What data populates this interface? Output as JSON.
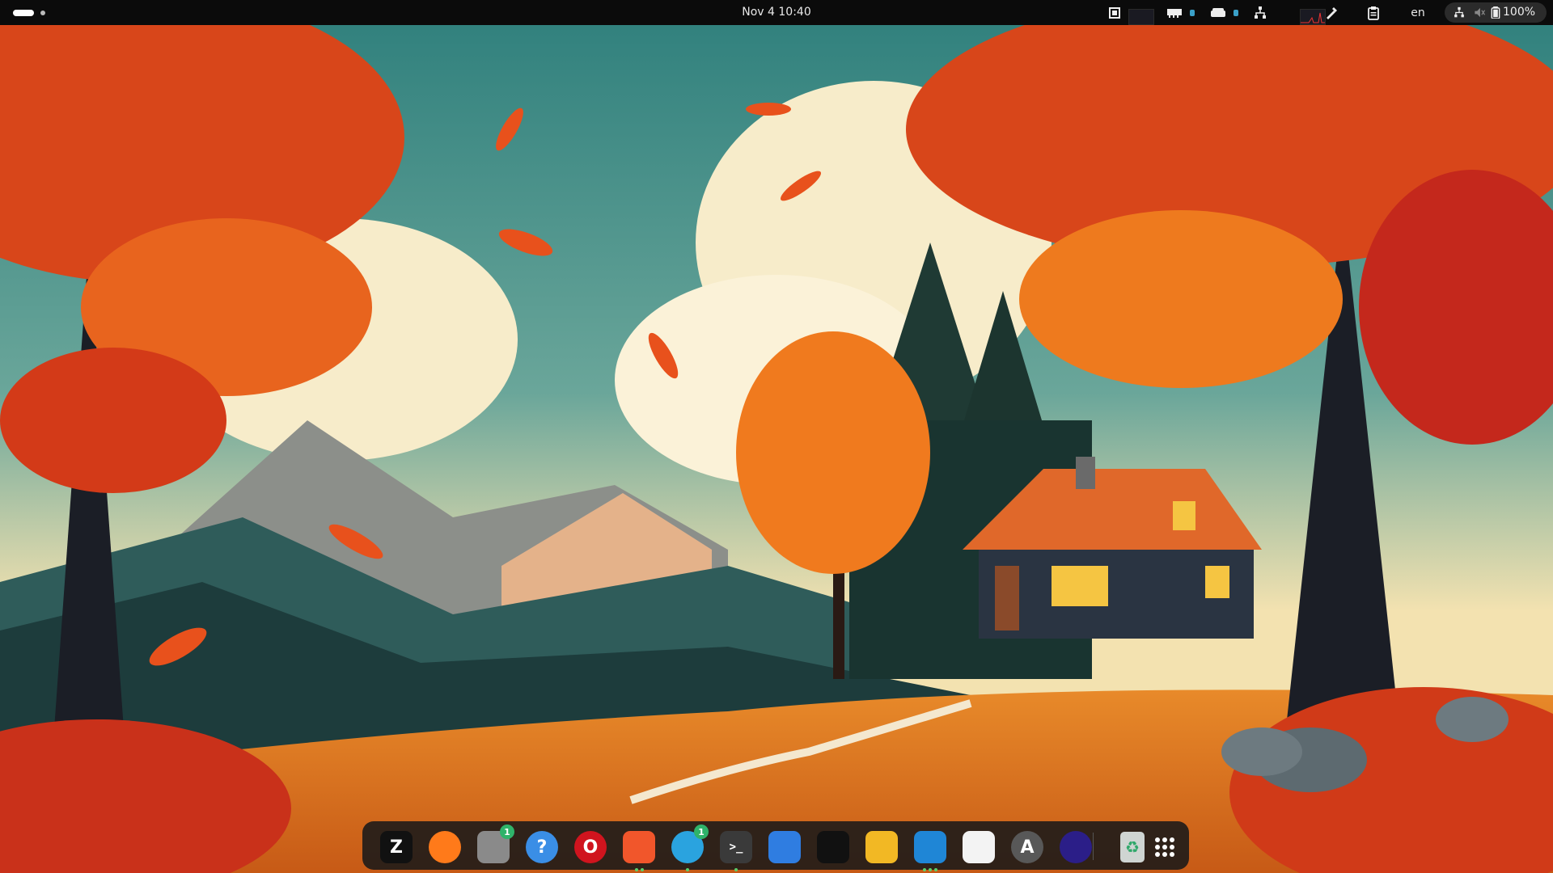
{
  "topbar": {
    "clock": "Nov 4  10:40",
    "keyboard_layout": "en",
    "battery": "100%"
  },
  "tray_icons": [
    "cpu-icon",
    "memory-icon",
    "disk-icon",
    "network-icon",
    "color-picker-icon",
    "clipboard-icon"
  ],
  "status_icons": [
    "network-icon",
    "volume-muted-icon",
    "battery-icon"
  ],
  "dock": {
    "apps": [
      {
        "name": "zed-editor",
        "glyph": "Z",
        "color": "#111111",
        "badge": "",
        "running": 0
      },
      {
        "name": "firefox",
        "glyph": "",
        "color": "#ff7a1a",
        "badge": "",
        "running": 0
      },
      {
        "name": "files",
        "glyph": "",
        "color": "#8a8a8a",
        "badge": "1",
        "running": 0
      },
      {
        "name": "help",
        "glyph": "?",
        "color": "#3a8ee6",
        "badge": "",
        "running": 0
      },
      {
        "name": "opera",
        "glyph": "O",
        "color": "#d0141e",
        "badge": "",
        "running": 0
      },
      {
        "name": "brave",
        "glyph": "",
        "color": "#f1562b",
        "badge": "",
        "running": 2
      },
      {
        "name": "telegram",
        "glyph": "",
        "color": "#2aa3df",
        "badge": "1",
        "running": 1
      },
      {
        "name": "terminal",
        "glyph": ">_",
        "color": "#3a3a3a",
        "badge": "",
        "running": 1
      },
      {
        "name": "text-editor",
        "glyph": "",
        "color": "#2f7de1",
        "badge": "",
        "running": 0
      },
      {
        "name": "app-black",
        "glyph": "",
        "color": "#111111",
        "badge": "",
        "running": 0
      },
      {
        "name": "app-yellow",
        "glyph": "",
        "color": "#f2b824",
        "badge": "",
        "running": 0
      },
      {
        "name": "vscode",
        "glyph": "",
        "color": "#1f86d6",
        "badge": "",
        "running": 3
      },
      {
        "name": "app-white",
        "glyph": "",
        "color": "#f3f3f3",
        "badge": "",
        "running": 0
      },
      {
        "name": "app-store",
        "glyph": "A",
        "color": "#585858",
        "badge": "",
        "running": 0
      },
      {
        "name": "app-purple",
        "glyph": "",
        "color": "#2b1e88",
        "badge": "",
        "running": 0
      }
    ],
    "pinned_extra": [
      {
        "name": "trash",
        "color": "#cfd5d2"
      },
      {
        "name": "app-grid",
        "color": "#ffffff"
      }
    ]
  }
}
